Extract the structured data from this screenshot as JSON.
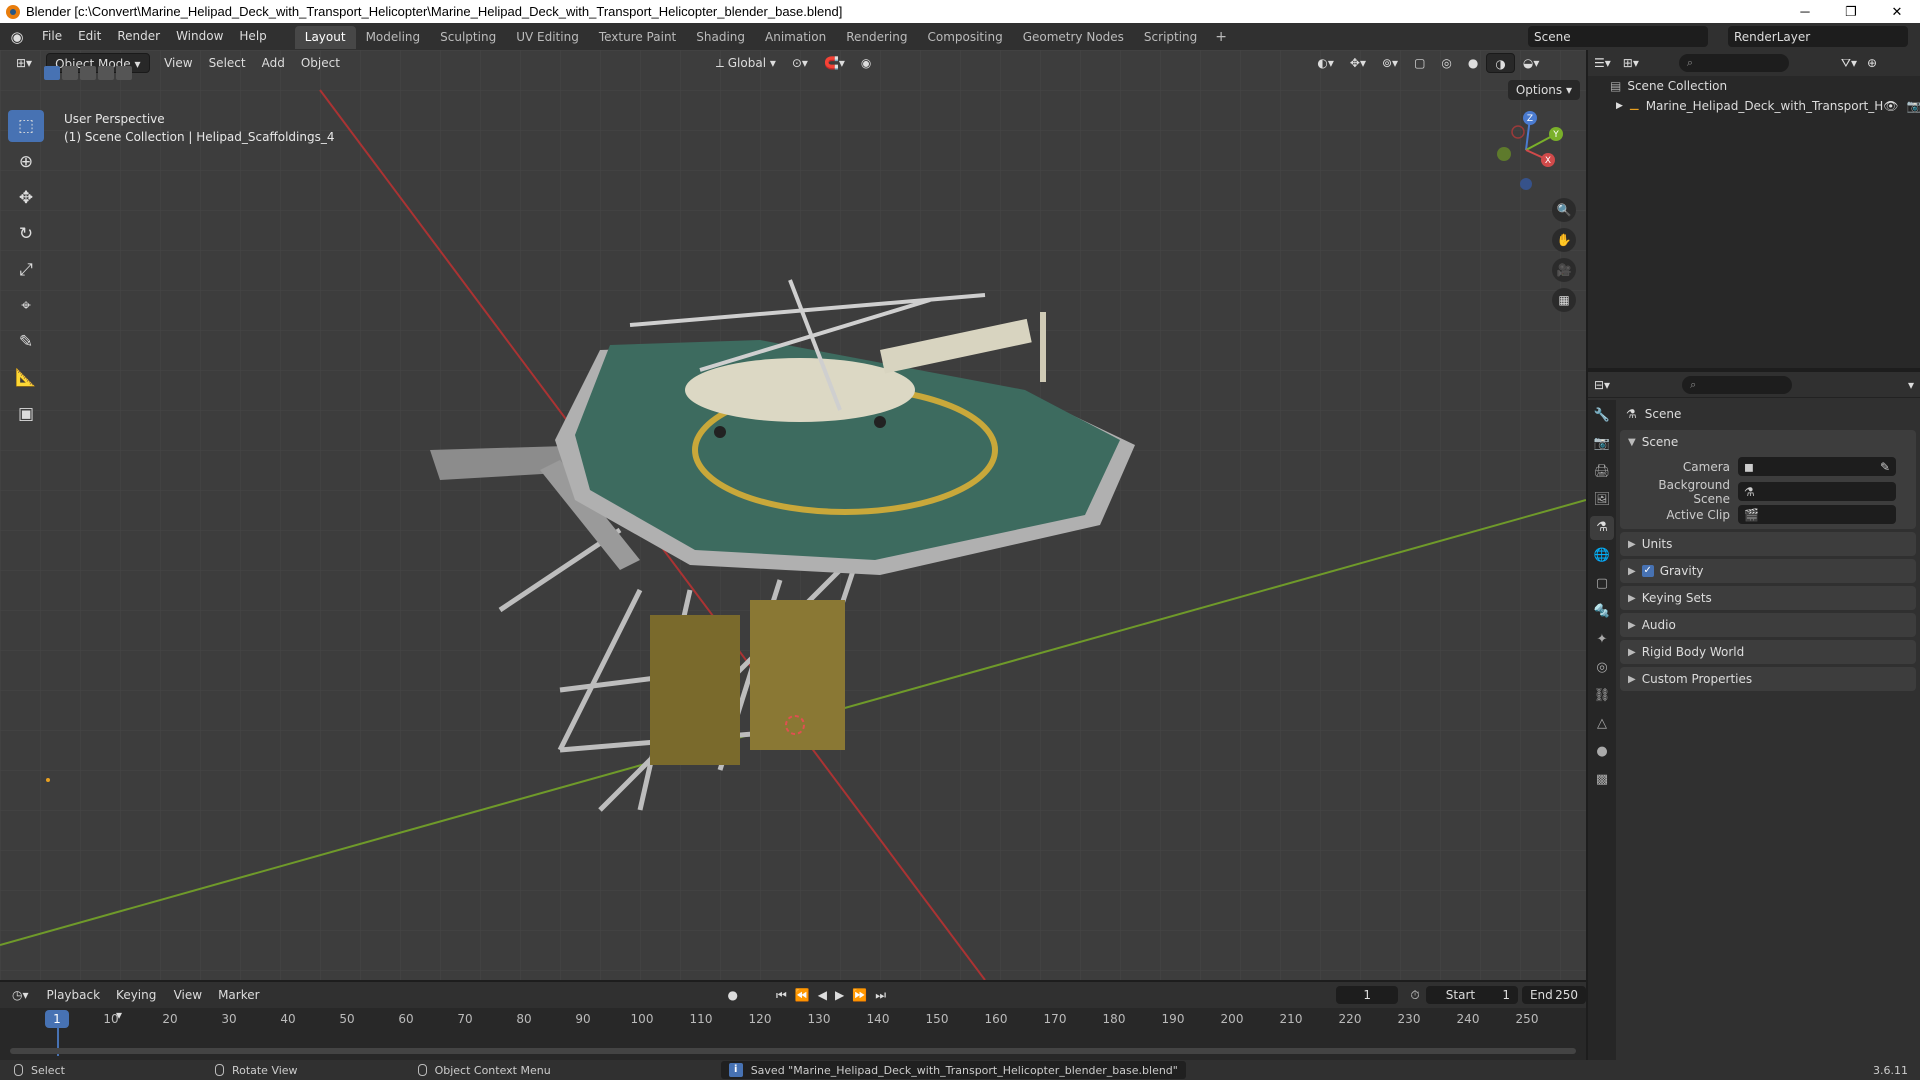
{
  "window": {
    "title": "Blender [c:\\Convert\\Marine_Helipad_Deck_with_Transport_Helicopter\\Marine_Helipad_Deck_with_Transport_Helicopter_blender_base.blend]"
  },
  "menu": [
    "File",
    "Edit",
    "Render",
    "Window",
    "Help"
  ],
  "workspaces": [
    "Layout",
    "Modeling",
    "Sculpting",
    "UV Editing",
    "Texture Paint",
    "Shading",
    "Animation",
    "Rendering",
    "Compositing",
    "Geometry Nodes",
    "Scripting"
  ],
  "workspace_add": "+",
  "scene_name": "Scene",
  "render_layer": "RenderLayer",
  "viewport": {
    "mode": "Object Mode",
    "menus": [
      "View",
      "Select",
      "Add",
      "Object"
    ],
    "orientation": "Global",
    "options": "Options",
    "info_line1": "User Perspective",
    "info_line2": "(1) Scene Collection | Helipad_Scaffoldings_4",
    "gizmo": {
      "z": "Z",
      "y": "Y",
      "x": "X"
    }
  },
  "outliner": {
    "collection": "Scene Collection",
    "item": "Marine_Helipad_Deck_with_Transport_H"
  },
  "properties": {
    "title": "Scene",
    "panel_scene": "Scene",
    "camera_label": "Camera",
    "bg_scene_label": "Background Scene",
    "active_clip_label": "Active Clip",
    "collapsed": [
      "Units",
      "Gravity",
      "Keying Sets",
      "Audio",
      "Rigid Body World",
      "Custom Properties"
    ]
  },
  "timeline": {
    "menus": [
      "Playback",
      "Keying",
      "View",
      "Marker"
    ],
    "current_frame": "1",
    "start_label": "Start",
    "start": "1",
    "end_label": "End",
    "end": "250",
    "ticks": [
      "10",
      "20",
      "30",
      "40",
      "50",
      "60",
      "70",
      "80",
      "90",
      "100",
      "110",
      "120",
      "130",
      "140",
      "150",
      "160",
      "170",
      "180",
      "190",
      "200",
      "210",
      "220",
      "230",
      "240",
      "250"
    ]
  },
  "status": {
    "select": "Select",
    "rotate": "Rotate View",
    "context": "Object Context Menu",
    "saved": "Saved \"Marine_Helipad_Deck_with_Transport_Helicopter_blender_base.blend\"",
    "version": "3.6.11"
  }
}
